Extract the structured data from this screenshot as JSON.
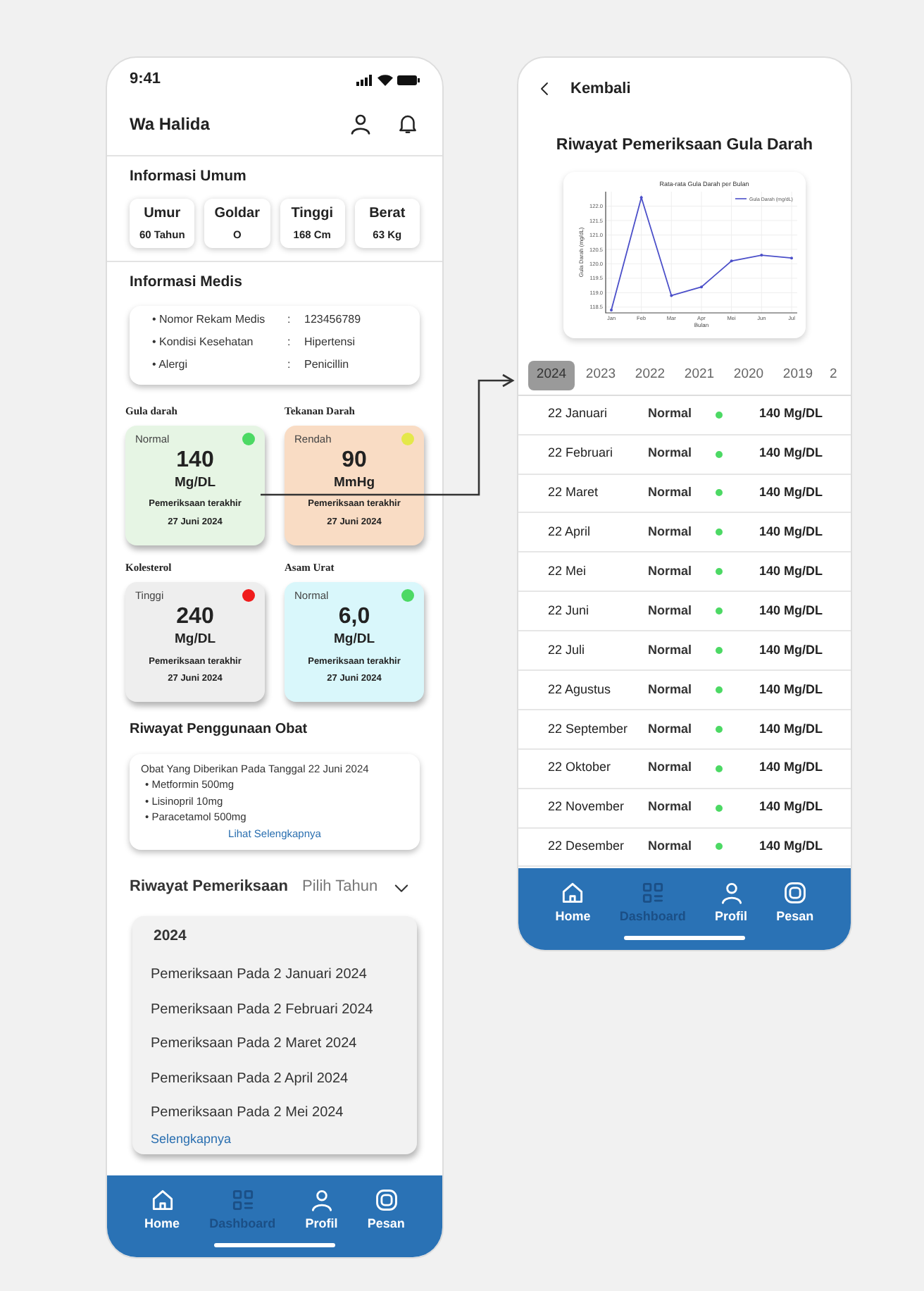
{
  "home_screen": {
    "status_time": "9:41",
    "user_name": "Wa Halida",
    "general_info": {
      "title": "Informasi Umum",
      "stats": [
        {
          "label": "Umur",
          "value": "60 Tahun"
        },
        {
          "label": "Goldar",
          "value": "O"
        },
        {
          "label": "Tinggi",
          "value": "168 Cm"
        },
        {
          "label": "Berat",
          "value": "63 Kg"
        }
      ]
    },
    "medical_info": {
      "title": "Informasi Medis",
      "rows": [
        {
          "label": "• Nomor Rekam Medis",
          "separator": ":",
          "value": "123456789"
        },
        {
          "label": "• Kondisi Kesehatan",
          "separator": ":",
          "value": "Hipertensi"
        },
        {
          "label": "• Alergi",
          "separator": ":",
          "value": "Penicillin"
        }
      ]
    },
    "vitals": [
      {
        "title": "Gula darah",
        "status": "Normal",
        "color": "#4cd964",
        "kind": "glucose",
        "value": "140",
        "unit": "Mg/DL",
        "caption": "Pemeriksaan terakhir",
        "date": "27 Juni 2024"
      },
      {
        "title": "Tekanan Darah",
        "status": "Rendah",
        "color": "#e4e84a",
        "kind": "pressure",
        "value": "90",
        "unit": "MmHg",
        "caption": "Pemeriksaan terakhir",
        "date": "27 Juni 2024"
      },
      {
        "title": "Kolesterol",
        "status": "Tinggi",
        "color": "#f01c1c",
        "kind": "cholesterol",
        "value": "240",
        "unit": "Mg/DL",
        "caption": "Pemeriksaan terakhir",
        "date": "27 Juni 2024"
      },
      {
        "title": "Asam Urat",
        "status": "Normal",
        "color": "#4cd964",
        "kind": "uric_acid",
        "value": "6,0",
        "unit": "Mg/DL",
        "caption": "Pemeriksaan terakhir",
        "date": "27 Juni 2024"
      }
    ],
    "medication": {
      "title": "Riwayat Penggunaan Obat",
      "heading": "Obat Yang Diberikan Pada Tanggal 22 Juni 2024",
      "items": [
        "• Metformin 500mg",
        "• Lisinopril 10mg",
        "• Paracetamol 500mg"
      ],
      "link": "Lihat Selengkapnya"
    },
    "exams": {
      "title": "Riwayat Pemeriksaan",
      "picker": "Pilih Tahun",
      "year": "2024",
      "items": [
        "Pemeriksaan Pada 2 Januari 2024",
        "Pemeriksaan Pada 2 Februari 2024",
        "Pemeriksaan Pada 2 Maret 2024",
        "Pemeriksaan Pada 2 April 2024",
        "Pemeriksaan Pada 2 Mei 2024"
      ],
      "link": "Selengkapnya"
    },
    "nav": [
      {
        "label": "Home",
        "kind": "home",
        "selected": false
      },
      {
        "label": "Dashboard",
        "kind": "dashboard",
        "selected": true
      },
      {
        "label": "Profil",
        "kind": "profile",
        "selected": false
      },
      {
        "label": "Pesan",
        "kind": "message",
        "selected": false
      }
    ]
  },
  "history_screen": {
    "back": "Kembali",
    "title": "Riwayat Pemeriksaan Gula Darah",
    "chart_data": {
      "type": "line",
      "title": "Rata-rata Gula Darah per Bulan",
      "xlabel": "Bulan",
      "ylabel": "Gula Darah (mg/dL)",
      "categories": [
        "Jan",
        "Feb",
        "Mar",
        "Apr",
        "Mei",
        "Jun",
        "Jul"
      ],
      "yticks": [
        118.5,
        {
          "value": 119,
          "label": "119.0"
        },
        119.5,
        {
          "value": 120,
          "label": "120.0"
        },
        120.5,
        {
          "value": 121,
          "label": "121.0"
        },
        121.5,
        {
          "value": 122,
          "label": "122.0"
        }
      ],
      "ylim": [
        118.3,
        122.5
      ],
      "grid": true,
      "series": [
        {
          "name": "Gula Darah (mg/dL)",
          "color": "#4b4fc9",
          "values": [
            118.4,
            122.3,
            118.9,
            119.2,
            120.1,
            120.3,
            120.2
          ]
        }
      ]
    },
    "years": [
      {
        "label": "2024",
        "selected": true
      },
      {
        "label": "2023",
        "selected": false
      },
      {
        "label": "2022",
        "selected": false
      },
      {
        "label": "2021",
        "selected": false
      },
      {
        "label": "2020",
        "selected": false
      },
      {
        "label": "2019",
        "selected": false
      },
      {
        "label": "2",
        "selected": false
      }
    ],
    "rows": [
      {
        "date": "22 Januari",
        "status": "Normal",
        "color": "#4cd964",
        "value": "140 Mg/DL"
      },
      {
        "date": "22 Februari",
        "status": "Normal",
        "color": "#4cd964",
        "value": "140 Mg/DL"
      },
      {
        "date": "22 Maret",
        "status": "Normal",
        "color": "#4cd964",
        "value": "140 Mg/DL"
      },
      {
        "date": "22 April",
        "status": "Normal",
        "color": "#4cd964",
        "value": "140 Mg/DL"
      },
      {
        "date": "22 Mei",
        "status": "Normal",
        "color": "#4cd964",
        "value": "140 Mg/DL"
      },
      {
        "date": "22 Juni",
        "status": "Normal",
        "color": "#4cd964",
        "value": "140 Mg/DL"
      },
      {
        "date": "22 Juli",
        "status": "Normal",
        "color": "#4cd964",
        "value": "140 Mg/DL"
      },
      {
        "date": "22 Agustus",
        "status": "Normal",
        "color": "#4cd964",
        "value": "140 Mg/DL"
      },
      {
        "date": "22 September",
        "status": "Normal",
        "color": "#4cd964",
        "value": "140 Mg/DL"
      },
      {
        "date": "22 Oktober",
        "status": "Normal",
        "color": "#4cd964",
        "value": "140 Mg/DL"
      },
      {
        "date": "22 November",
        "status": "Normal",
        "color": "#4cd964",
        "value": "140 Mg/DL"
      },
      {
        "date": "22 Desember",
        "status": "Normal",
        "color": "#4cd964",
        "value": "140 Mg/DL"
      }
    ],
    "nav": [
      {
        "label": "Home",
        "kind": "home",
        "selected": false
      },
      {
        "label": "Dashboard",
        "kind": "dashboard",
        "selected": true
      },
      {
        "label": "Profil",
        "kind": "profile",
        "selected": false
      },
      {
        "label": "Pesan",
        "kind": "message",
        "selected": false
      }
    ]
  }
}
